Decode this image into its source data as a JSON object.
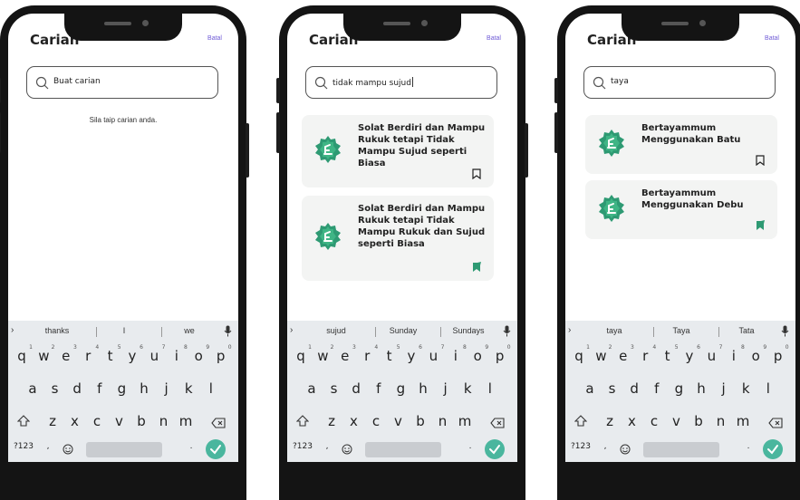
{
  "phones": [
    {
      "title": "Carian",
      "cancel_label": "Batal",
      "search": {
        "text": "Buat carian",
        "caret": false
      },
      "hint": "Sila taip carian anda.",
      "results": [],
      "suggestions": [
        "thanks",
        "I",
        "we"
      ]
    },
    {
      "title": "Carian",
      "cancel_label": "Batal",
      "search": {
        "text": "tidak mampu sujud",
        "caret": true
      },
      "hint": "",
      "results": [
        {
          "title": "Solat Berdiri dan Mampu Rukuk tetapi Tidak Mampu Sujud seperti Biasa",
          "bookmarked": false
        },
        {
          "title": "Solat Berdiri dan Mampu Rukuk tetapi Tidak Mampu Rukuk dan Sujud seperti Biasa",
          "bookmarked": true
        }
      ],
      "suggestions": [
        "sujud",
        "Sunday",
        "Sundays"
      ]
    },
    {
      "title": "Carian",
      "cancel_label": "Batal",
      "search": {
        "text": "taya",
        "caret": false
      },
      "hint": "",
      "results": [
        {
          "title": "Bertayammum Menggunakan Batu",
          "bookmarked": false
        },
        {
          "title": "Bertayammum Menggunakan Debu",
          "bookmarked": true
        }
      ],
      "suggestions": [
        "taya",
        "Taya",
        "Tata"
      ]
    }
  ],
  "keyboard": {
    "row1": [
      "q",
      "w",
      "e",
      "r",
      "t",
      "y",
      "u",
      "i",
      "o",
      "p"
    ],
    "row1_hints": [
      "1",
      "2",
      "3",
      "4",
      "5",
      "6",
      "7",
      "8",
      "9",
      "0"
    ],
    "row2": [
      "a",
      "s",
      "d",
      "f",
      "g",
      "h",
      "j",
      "k",
      "l"
    ],
    "row3": [
      "z",
      "x",
      "c",
      "v",
      "b",
      "n",
      "m"
    ],
    "symbols_label": "?123",
    "comma": ",",
    "period": "."
  },
  "colors": {
    "accent": "#6f5bd6",
    "brand_green": "#2e9a73",
    "enter_key": "#4ab69e",
    "card_bg": "#f3f4f3",
    "keyboard_bg": "#e8ebee"
  }
}
